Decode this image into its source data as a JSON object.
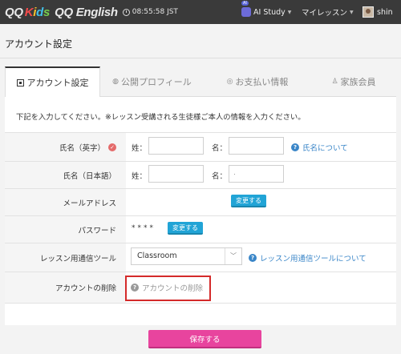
{
  "header": {
    "logo_qq": "QQ",
    "logo_kids": [
      "K",
      "i",
      "d",
      "s"
    ],
    "logo_english": "QQ English",
    "clock": "08:55:58 JST",
    "ai_badge": "AI",
    "ai_study": "AI Study",
    "my_lesson": "マイレッスン",
    "user_name": "shin"
  },
  "page": {
    "title": "アカウント設定"
  },
  "tabs": [
    {
      "label": "アカウント設定",
      "icon": "id-card-icon"
    },
    {
      "label": "公開プロフィール",
      "icon": "globe-icon"
    },
    {
      "label": "お支払い情報",
      "icon": "coin-icon"
    },
    {
      "label": "家族会員",
      "icon": "family-icon"
    }
  ],
  "form": {
    "intro": "下記を入力してください。※レッスン受講される生徒様ご本人の情報を入力ください。",
    "name_en": {
      "label": "氏名（英字）",
      "sei": "姓：",
      "mei": "名：",
      "help": "氏名について",
      "sei_value": "",
      "mei_value": ""
    },
    "name_jp": {
      "label": "氏名（日本語）",
      "sei": "姓：",
      "mei": "名：",
      "sei_value": "",
      "mei_value": "·"
    },
    "email": {
      "label": "メールアドレス",
      "button": "変更する"
    },
    "password": {
      "label": "パスワード",
      "mask": "****",
      "button": "変更する"
    },
    "tool": {
      "label": "レッスン用通信ツール",
      "selected": "Classroom",
      "help": "レッスン用通信ツールについて"
    },
    "delete": {
      "label": "アカウントの削除",
      "link": "アカウントの削除"
    },
    "save": "保存する"
  }
}
